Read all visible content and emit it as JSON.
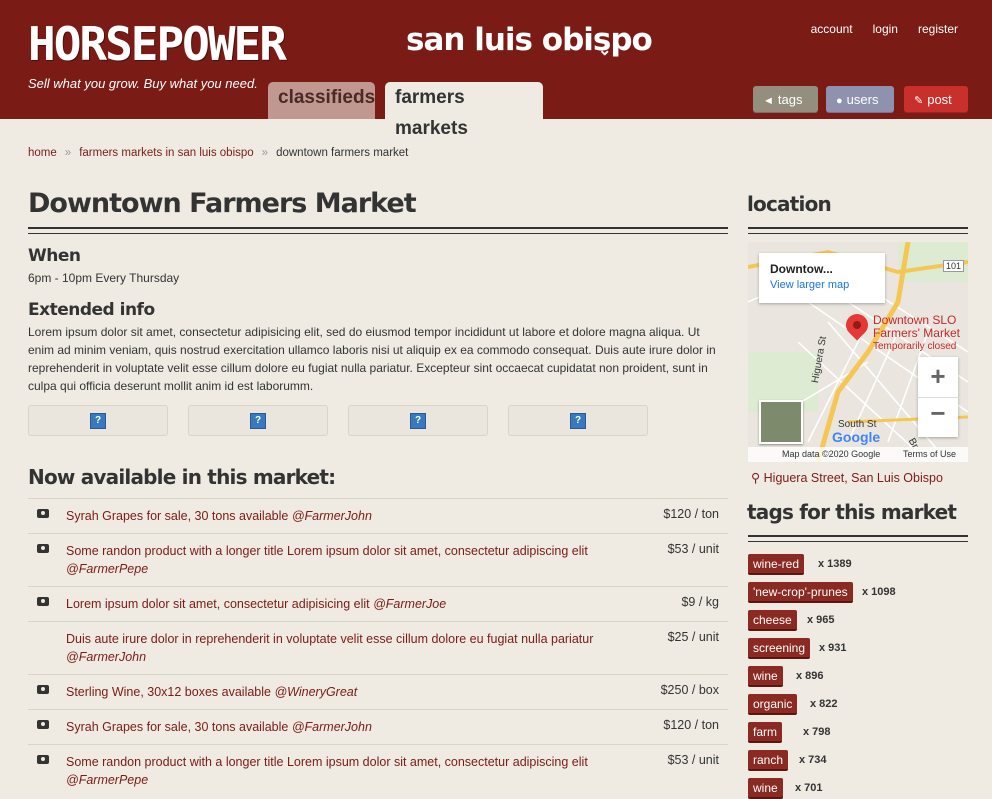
{
  "header": {
    "logo": "HORSEPOWER",
    "tagline": "Sell what you grow. Buy what you need.",
    "city": "san luis obispo",
    "links": [
      "account",
      "login",
      "register"
    ],
    "tabs": {
      "classifieds": "classifieds",
      "farmers": "farmers markets"
    },
    "buttons": {
      "tags": "tags",
      "users": "users",
      "post": "post"
    }
  },
  "breadcrumb": {
    "home": "home",
    "markets": "farmers markets in san luis obispo",
    "current": "downtown farmers market"
  },
  "market": {
    "title": "Downtown Farmers Market",
    "when_label": "When",
    "when": "6pm - 10pm Every Thursday",
    "extended_label": "Extended info",
    "extended": "Lorem ipsum dolor sit amet, consectetur adipisicing elit, sed do eiusmod tempor incididunt ut labore et dolore magna aliqua. Ut enim ad minim veniam, quis nostrud exercitation ullamco laboris nisi ut aliquip ex ea commodo consequat. Duis aute irure dolor in reprehenderit in voluptate velit esse cillum dolore eu fugiat nulla pariatur. Excepteur sint occaecat cupidatat non proident, sunt in culpa qui officia deserunt mollit anim id est laborumm."
  },
  "listings_heading": "Now available in this market:",
  "listings": [
    {
      "title": "Syrah Grapes for sale, 30 tons available",
      "user": "@FarmerJohn",
      "price": "$120 / ton",
      "photo": true
    },
    {
      "title": "Some randon product with a longer title Lorem ipsum dolor sit amet, consectetur adipiscing elit",
      "user": "@FarmerPepe",
      "price": "$53 / unit",
      "photo": true
    },
    {
      "title": "Lorem ipsum dolor sit amet, consectetur adipisicing elit",
      "user": "@FarmerJoe",
      "price": "$9 / kg",
      "photo": true
    },
    {
      "title": "Duis aute irure dolor in reprehenderit in voluptate velit esse cillum dolore eu fugiat nulla pariatur",
      "user": "@FarmerJohn",
      "price": "$25 / unit",
      "photo": false
    },
    {
      "title": "Sterling Wine, 30x12 boxes available",
      "user": "@WineryGreat",
      "price": "$250 / box",
      "photo": true
    },
    {
      "title": "Syrah Grapes for sale, 30 tons available",
      "user": "@FarmerJohn",
      "price": "$120 / ton",
      "photo": true
    },
    {
      "title": "Some randon product with a longer title Lorem ipsum dolor sit amet, consectetur adipiscing elit",
      "user": "@FarmerPepe",
      "price": "$53 / unit",
      "photo": true
    }
  ],
  "sidebar": {
    "location_heading": "location",
    "map": {
      "card_title": "Downtow...",
      "card_link": "View larger map",
      "place_name": "Downtown SLO Farmers' Market",
      "place_status": "Temporarily closed",
      "streets": [
        "Higuera St",
        "South St",
        "Br"
      ],
      "route": "101",
      "google": "Google",
      "attribution": "Map data ©2020 Google",
      "terms": "Terms of Use"
    },
    "address": "Higuera Street, San Luis Obispo",
    "tags_heading": "tags for this market",
    "tags": [
      {
        "name": "wine-red",
        "count": "x 1389"
      },
      {
        "name": "'new-crop'-prunes",
        "count": "x 1098"
      },
      {
        "name": "cheese",
        "count": "x 965"
      },
      {
        "name": "screening",
        "count": "x 931"
      },
      {
        "name": "wine",
        "count": "x 896"
      },
      {
        "name": "organic",
        "count": "x 822"
      },
      {
        "name": "farm",
        "count": "x 798"
      },
      {
        "name": "ranch",
        "count": "x 734"
      },
      {
        "name": "wine",
        "count": "x 701"
      }
    ]
  },
  "colors": {
    "brand": "#7a1b15",
    "background": "#efebe3",
    "post_button": "#c9302c"
  }
}
